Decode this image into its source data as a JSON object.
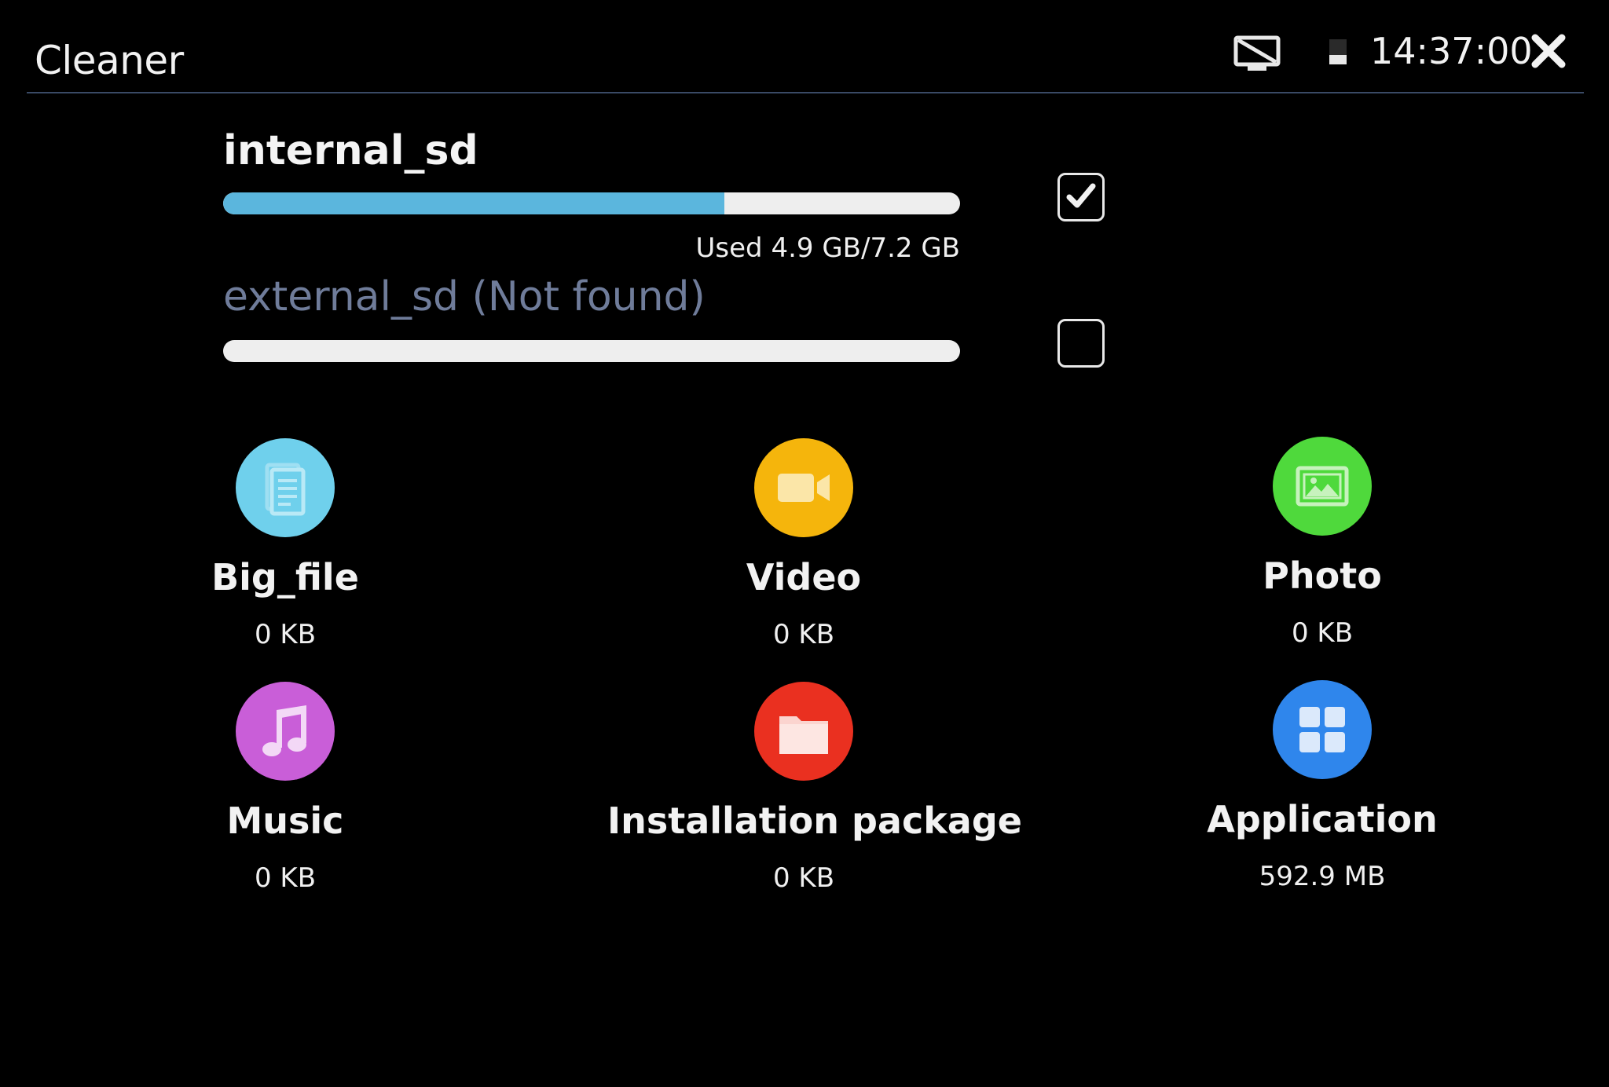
{
  "header": {
    "title": "Cleaner",
    "clock": "14:37:00"
  },
  "storage": [
    {
      "name": "internal_sd",
      "used_text": "Used 4.9 GB/7.2 GB",
      "used_fraction": 0.68,
      "checked": true
    },
    {
      "name": "external_sd (Not found)",
      "used_fraction": 0,
      "checked": false
    }
  ],
  "categories": [
    {
      "label": "Big_file",
      "size": "0 KB",
      "color": "#6fd0ec",
      "icon": "document-icon"
    },
    {
      "label": "Video",
      "size": "0 KB",
      "color": "#f5b50c",
      "icon": "video-camera-icon"
    },
    {
      "label": "Photo",
      "size": "0 KB",
      "color": "#4fd93c",
      "icon": "image-icon"
    },
    {
      "label": "Music",
      "size": "0 KB",
      "color": "#c95ed8",
      "icon": "music-note-icon"
    },
    {
      "label": "Installation package",
      "size": "0 KB",
      "color": "#ea3020",
      "icon": "folder-icon"
    },
    {
      "label": "Application",
      "size": "592.9 MB",
      "color": "#2f86ec",
      "icon": "apps-grid-icon"
    }
  ]
}
